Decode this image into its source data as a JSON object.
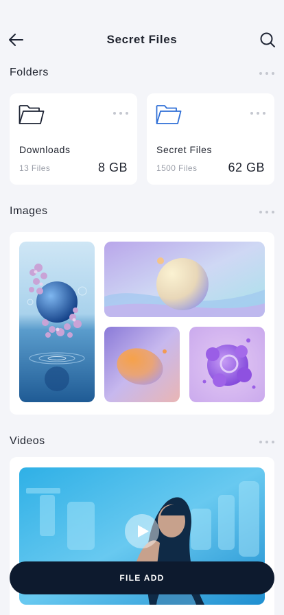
{
  "header": {
    "title": "Secret Files",
    "back_icon": "arrow-left-icon",
    "search_icon": "search-icon"
  },
  "folders": {
    "section_title": "Folders",
    "items": [
      {
        "name": "Downloads",
        "count": "13 Files",
        "size": "8 GB",
        "icon": "folder-icon",
        "icon_color": "#1d2333"
      },
      {
        "name": "Secret Files",
        "count": "1500 Files",
        "size": "62 GB",
        "icon": "folder-icon",
        "icon_color": "#2f6fd6"
      }
    ]
  },
  "images": {
    "section_title": "Images",
    "thumbnails": [
      {
        "name": "floral-sphere-image"
      },
      {
        "name": "pastel-sphere-image"
      },
      {
        "name": "orange-egg-image"
      },
      {
        "name": "purple-blob-image"
      }
    ]
  },
  "videos": {
    "section_title": "Videos",
    "thumbnails": [
      {
        "name": "woman-underwater-video"
      }
    ],
    "play_icon": "play-icon"
  },
  "actions": {
    "file_add_label": "FILE ADD"
  },
  "colors": {
    "background": "#f4f5f9",
    "card": "#ffffff",
    "primary_button": "#0d1a2e",
    "accent_blue": "#2f6fd6"
  }
}
